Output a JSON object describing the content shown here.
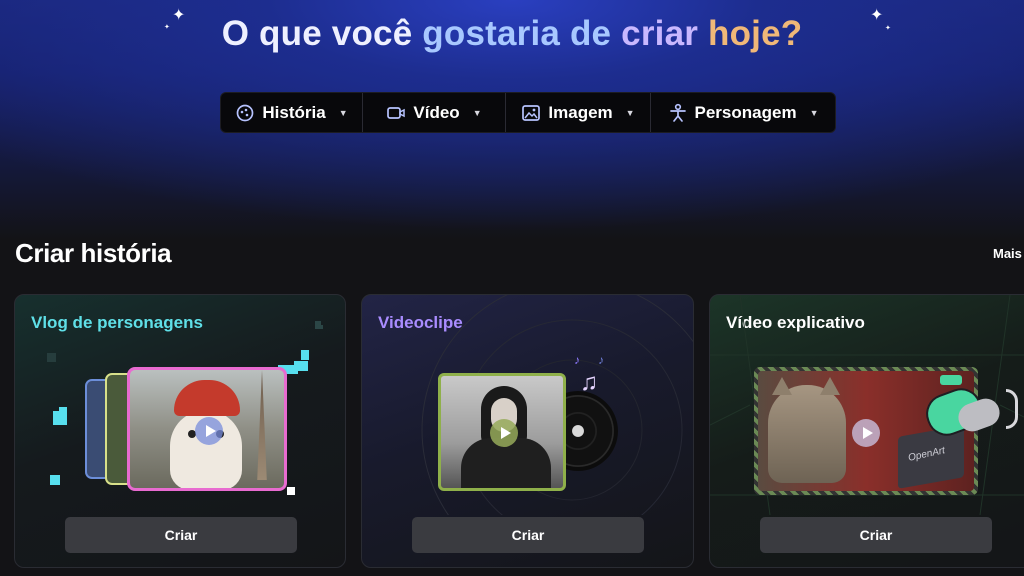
{
  "headline": {
    "w1": "O que você ",
    "w2": "gostaria de ",
    "w3": "criar ",
    "w4": "hoje?"
  },
  "tabs": [
    {
      "label": "História",
      "icon": "story-icon"
    },
    {
      "label": "Vídeo",
      "icon": "video-icon"
    },
    {
      "label": "Imagem",
      "icon": "image-icon"
    },
    {
      "label": "Personagem",
      "icon": "character-icon"
    }
  ],
  "section": {
    "title": "Criar história",
    "more": "Mais"
  },
  "cards": [
    {
      "title": "Vlog de personagens",
      "button": "Criar"
    },
    {
      "title": "Videoclipe",
      "button": "Criar"
    },
    {
      "title": "Vídeo explicativo",
      "button": "Criar",
      "watermark": "OpenArt"
    }
  ],
  "colors": {
    "accent_cyan": "#5fe0e8",
    "accent_purple": "#a98cff",
    "button_bg": "#3a3b40"
  }
}
